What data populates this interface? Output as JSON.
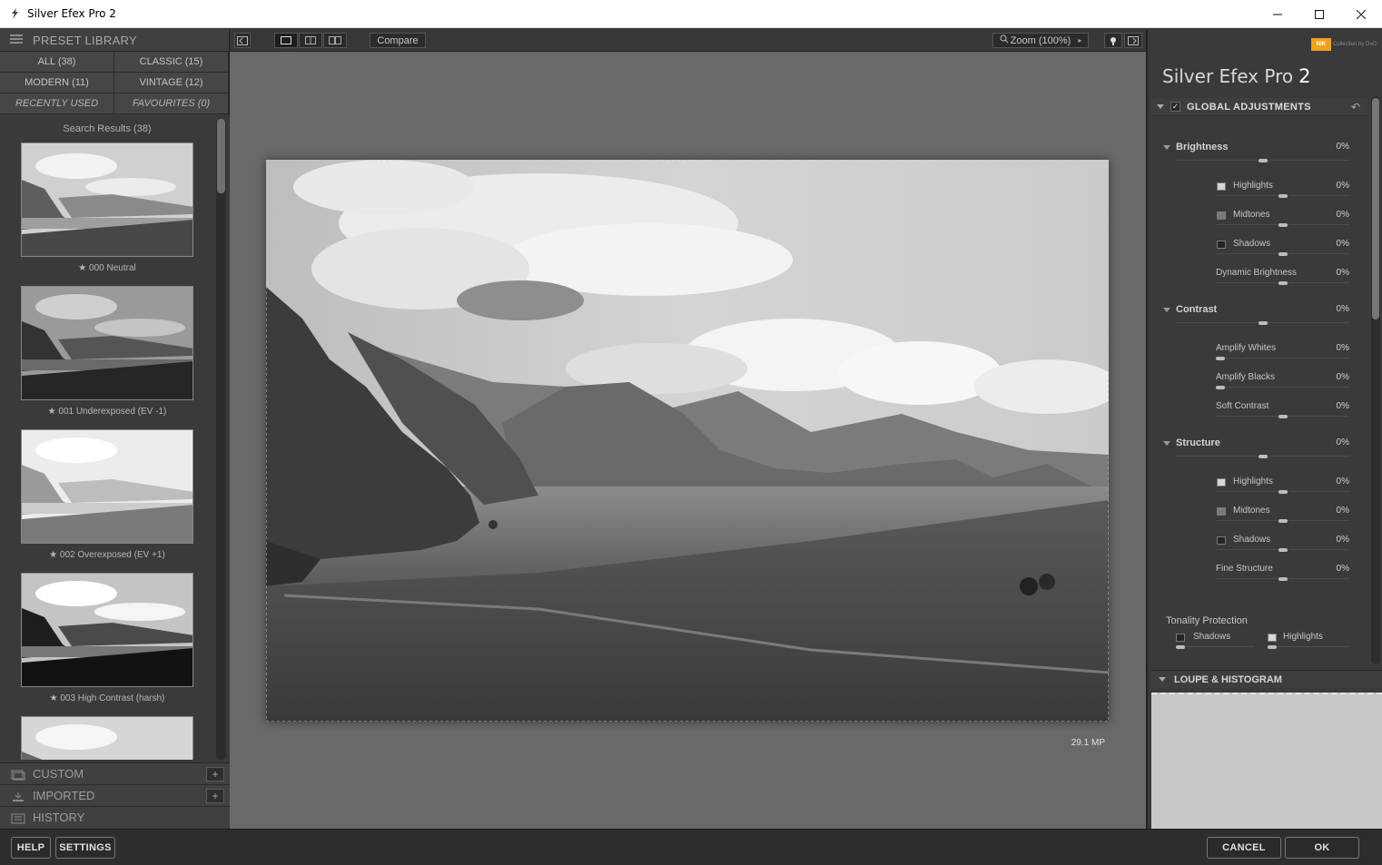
{
  "window": {
    "title": "Silver Efex Pro 2"
  },
  "left": {
    "library_title": "PRESET LIBRARY",
    "categories": [
      {
        "label": "ALL (38)"
      },
      {
        "label": "CLASSIC (15)"
      },
      {
        "label": "MODERN (11)"
      },
      {
        "label": "VINTAGE (12)"
      },
      {
        "label": "RECENTLY USED"
      },
      {
        "label": "FAVOURITES (0)"
      }
    ],
    "search_results": "Search Results (38)",
    "presets": [
      {
        "label": "★ 000 Neutral"
      },
      {
        "label": "★ 001 Underexposed (EV -1)"
      },
      {
        "label": "★ 002 Overexposed (EV +1)"
      },
      {
        "label": "★ 003 High Contrast (harsh)"
      }
    ],
    "sections": [
      {
        "label": "CUSTOM"
      },
      {
        "label": "IMPORTED"
      },
      {
        "label": "HISTORY"
      }
    ]
  },
  "toolbar": {
    "compare": "Compare",
    "zoom": "Zoom (100%)"
  },
  "canvas": {
    "megapixels": "29.1 MP"
  },
  "right": {
    "brand": "Collection by DxO",
    "brand_logo": "NIK",
    "product": "Silver Efex Pro",
    "version": "2",
    "global_adjustments": "GLOBAL ADJUSTMENTS",
    "brightness": {
      "label": "Brightness",
      "value": "0%",
      "highlights": {
        "label": "Highlights",
        "value": "0%"
      },
      "midtones": {
        "label": "Midtones",
        "value": "0%"
      },
      "shadows": {
        "label": "Shadows",
        "value": "0%"
      },
      "dynamic": {
        "label": "Dynamic Brightness",
        "value": "0%"
      }
    },
    "contrast": {
      "label": "Contrast",
      "value": "0%",
      "amplify_whites": {
        "label": "Amplify Whites",
        "value": "0%"
      },
      "amplify_blacks": {
        "label": "Amplify Blacks",
        "value": "0%"
      },
      "soft": {
        "label": "Soft Contrast",
        "value": "0%"
      }
    },
    "structure": {
      "label": "Structure",
      "value": "0%",
      "highlights": {
        "label": "Highlights",
        "value": "0%"
      },
      "midtones": {
        "label": "Midtones",
        "value": "0%"
      },
      "shadows": {
        "label": "Shadows",
        "value": "0%"
      },
      "fine": {
        "label": "Fine Structure",
        "value": "0%"
      }
    },
    "tonality": {
      "label": "Tonality Protection",
      "shadows": "Shadows",
      "highlights": "Highlights"
    },
    "loupe": "LOUPE & HISTOGRAM"
  },
  "bottom": {
    "help": "HELP",
    "settings": "SETTINGS",
    "cancel": "CANCEL",
    "ok": "OK"
  }
}
